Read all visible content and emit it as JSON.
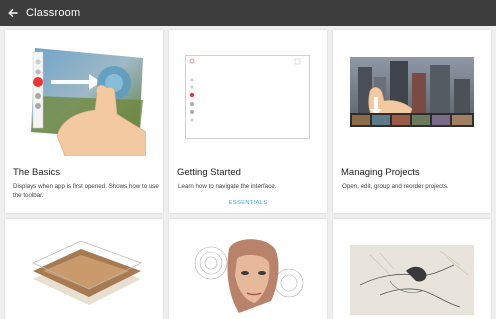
{
  "app": {
    "title": "Classroom"
  },
  "cards": [
    {
      "title": "The Basics",
      "description": "Displays when app is first opened. Shows how to use the toolbar.",
      "link": ""
    },
    {
      "title": "Getting Started",
      "description": "Learn how to navigate the interface.",
      "link": "ESSENTIALS"
    },
    {
      "title": "Managing Projects",
      "description": "Open, edit, group and reorder projects.",
      "link": ""
    }
  ],
  "colors": {
    "appbar": "#3d3d3d",
    "background": "#efefef",
    "card": "#ffffff",
    "link": "#42a5dc",
    "active_dot": "#e53935"
  },
  "icons": {
    "back": "arrow-left-icon"
  }
}
